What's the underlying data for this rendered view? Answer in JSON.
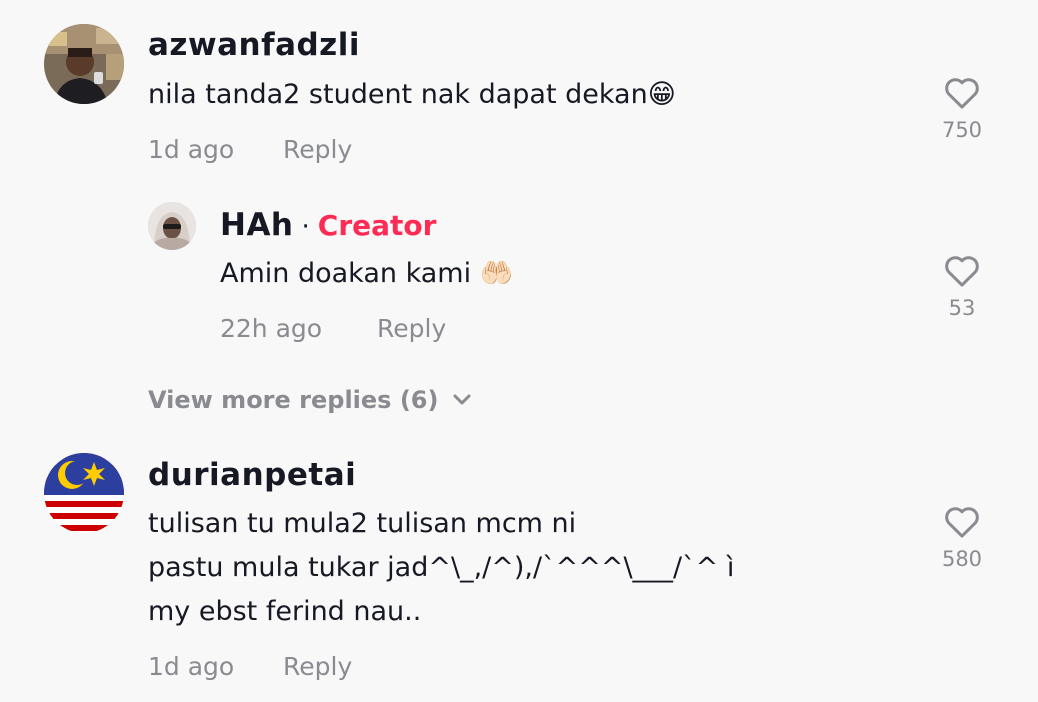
{
  "comments": [
    {
      "username": "azwanfadzli",
      "text_lines": [
        "nila tanda2 student nak dapat dekan😁"
      ],
      "time": "1d ago",
      "reply_label": "Reply",
      "likes": "750",
      "replies": [
        {
          "username": "HAh",
          "separator": "·",
          "badge": "Creator",
          "text_lines": [
            "Amin doakan kami 🤲🏻"
          ],
          "time": "22h ago",
          "reply_label": "Reply",
          "likes": "53"
        }
      ],
      "view_more": "View more replies (6)"
    },
    {
      "username": "durianpetai",
      "text_lines": [
        "tulisan tu mula2 tulisan mcm ni",
        "pastu mula tukar jad^\\_,/^),/`^^^\\___/`^ ì",
        "my ebst ferind nau.."
      ],
      "time": "1d ago",
      "reply_label": "Reply",
      "likes": "580"
    }
  ],
  "icons": {
    "like": "heart-outline-icon",
    "expand": "chevron-down-icon"
  },
  "colors": {
    "background": "#f8f8f8",
    "primary_text": "#161823",
    "secondary_text": "#8a8b91",
    "creator_badge": "#fe2c55"
  }
}
